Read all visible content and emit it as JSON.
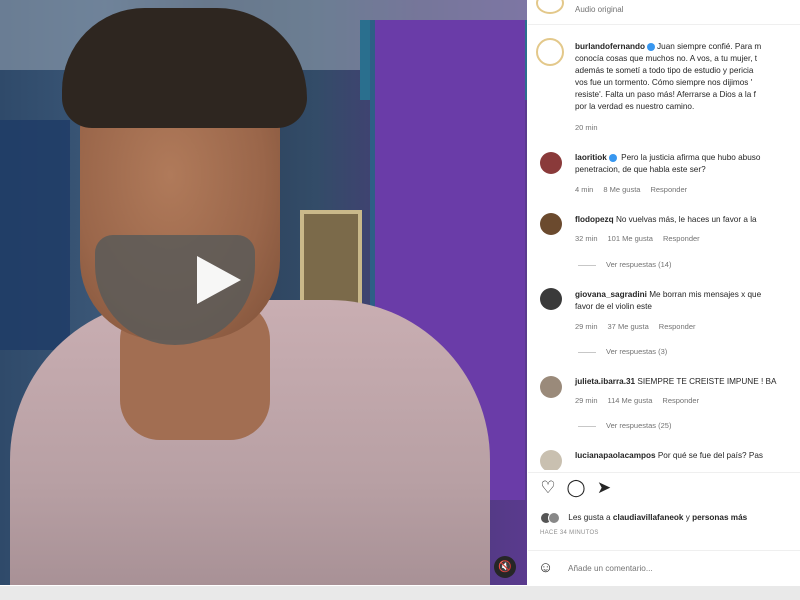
{
  "header": {
    "subtitle": "Audio original"
  },
  "caption": {
    "username": "burlandofernando",
    "lines": [
      "Juan siempre confié. Para m",
      "conocía cosas que muchos no. A vos, a tu mujer, t",
      "además te sometí a todo tipo de estudio y pericia",
      "vos fue un tormento. Cómo siempre nos dijimos '",
      "resiste'. Falta un paso más! Aferrarse a Dios a la f",
      "por la verdad es nuestro camino."
    ],
    "time": "20 min"
  },
  "comments": [
    {
      "username": "laoritiok",
      "lines": [
        "Pero la justicia afirma que hubo abuso",
        "penetracion, de que habla este ser?"
      ],
      "time": "4 min",
      "likes": "8 Me gusta",
      "reply": "Responder",
      "replies_label": "",
      "avatar_color": "#8a3a3a"
    },
    {
      "username": "flodopezq",
      "lines": [
        "No vuelvas más, le haces un favor a la"
      ],
      "time": "32 min",
      "likes": "101 Me gusta",
      "reply": "Responder",
      "replies_label": "Ver respuestas (14)",
      "avatar_color": "#6b4a2e"
    },
    {
      "username": "giovana_sagradini",
      "lines": [
        "Me borran mis mensajes x que",
        "favor de el violin este"
      ],
      "time": "29 min",
      "likes": "37 Me gusta",
      "reply": "Responder",
      "replies_label": "Ver respuestas (3)",
      "avatar_color": "#3a3a3a"
    },
    {
      "username": "julieta.ibarra.31",
      "lines": [
        "SIEMPRE TE CREISTE IMPUNE ! BA"
      ],
      "time": "29 min",
      "likes": "114 Me gusta",
      "reply": "Responder",
      "replies_label": "Ver respuestas (25)",
      "avatar_color": "#9a8a7a"
    },
    {
      "username": "lucianapaolacampos",
      "lines": [
        "Por qué se fue del país? Pas"
      ],
      "time": "",
      "likes": "",
      "reply": "",
      "replies_label": "",
      "avatar_color": "#c9c0b0"
    }
  ],
  "likes": {
    "prefix": "Les gusta a",
    "user": "claudiavillafaneok",
    "connector": "y",
    "others": "personas más"
  },
  "timestamp": "HACE 34 MINUTOS",
  "comment_box": {
    "placeholder": "Añade un comentario..."
  },
  "icons": {
    "like": "heart-icon",
    "comment": "comment-icon",
    "share": "send-icon",
    "emoji": "emoji-icon",
    "play": "play-icon",
    "mute": "mute-icon"
  }
}
